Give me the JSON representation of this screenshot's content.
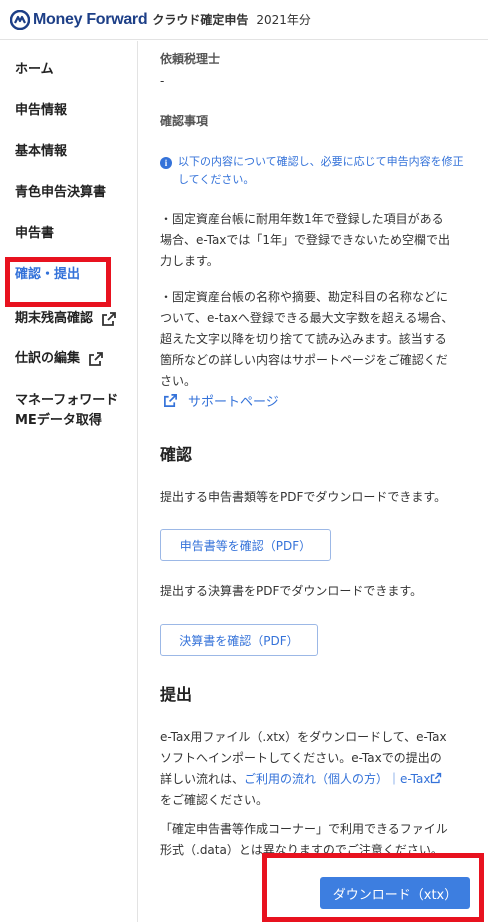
{
  "header": {
    "brand": "Money Forward",
    "product": "クラウド確定申告",
    "year": "2021年分"
  },
  "sidebar": {
    "items": [
      {
        "label": "ホーム"
      },
      {
        "label": "申告情報"
      },
      {
        "label": "基本情報"
      },
      {
        "label": "青色申告決算書"
      },
      {
        "label": "申告書"
      },
      {
        "label": "確認・提出",
        "active": true
      },
      {
        "label": "期末残高確認",
        "external": true
      },
      {
        "label": "仕訳の編集",
        "external": true
      },
      {
        "label_line1": "マネーフォワード",
        "label_line2": "MEデータ取得"
      }
    ]
  },
  "main": {
    "tax_accountant_label": "依頼税理士",
    "tax_accountant_value": "-",
    "confirm_items_label": "確認事項",
    "info_line1": "以下の内容について確認し、必要に応じて申告内容を修正",
    "info_line2": "してください。",
    "note1": [
      "・固定資産台帳に耐用年数1年で登録した項目がある",
      "場合、e-Taxでは「1年」で登録できないため空欄で出",
      "力します。"
    ],
    "note2": [
      "・固定資産台帳の名称や摘要、勘定科目の名称などに",
      "ついて、e-taxへ登録できる最大文字数を超える場合、",
      "超えた文字以降を切り捨てて読み込みます。該当する",
      "箇所などの詳しい内容はサポートページをご確認くだ",
      "さい。"
    ],
    "support_link": "サポートページ",
    "confirm_heading": "確認",
    "confirm_desc1": "提出する申告書類等をPDFでダウンロードできます。",
    "confirm_btn1": "申告書等を確認（PDF）",
    "confirm_desc2": "提出する決算書をPDFでダウンロードできます。",
    "confirm_btn2": "決算書を確認（PDF）",
    "submit_heading": "提出",
    "submit_line1": "e-Tax用ファイル（.xtx）をダウンロードして、e-Tax",
    "submit_line2": "ソフトへインポートしてください。e-Taxでの提出の",
    "submit_line3_pre": "詳しい流れは、",
    "submit_link1": "ご利用の流れ（個人の方）",
    "submit_sep": "｜",
    "submit_link2": "e-Tax",
    "submit_line4": "をご確認ください。",
    "caution_line1": "「確定申告書等作成コーナー」で利用できるファイル",
    "caution_line2": "形式（.data）とは異なりますのでご注意ください。",
    "download_btn": "ダウンロード（xtx）"
  },
  "colors": {
    "accent": "#3472d9",
    "brand": "#1d3f87",
    "highlight": "#e8121f"
  }
}
